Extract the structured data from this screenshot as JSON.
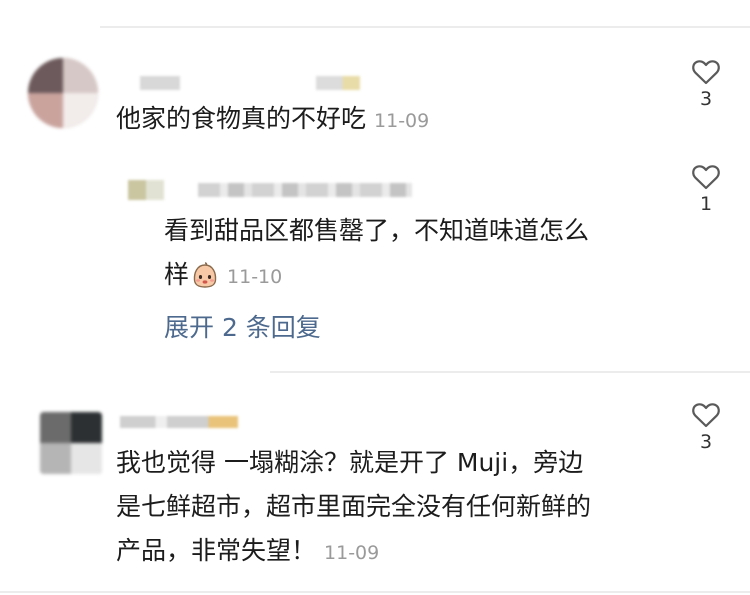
{
  "comments": [
    {
      "text": "他家的食物真的不好吃",
      "time": "11-09",
      "likes": "3"
    },
    {
      "text_line1": "看到甜品区都售罄了，不知道味道怎么",
      "text_line2": "样",
      "emoji": "crying-face-emoji",
      "time": "11-10",
      "likes": "1",
      "expand_label": "展开 2 条回复"
    },
    {
      "text_line1": "我也觉得 一塌糊涂？就是开了 Muji，旁边",
      "text_line2": "是七鲜超市，超市里面完全没有任何新鲜的",
      "text_line3": "产品，非常失望！",
      "time": "11-09",
      "likes": "3"
    }
  ],
  "colors": {
    "link": "#4d6a8e",
    "timestamp": "#9a9a9a",
    "divider": "#ececec"
  }
}
